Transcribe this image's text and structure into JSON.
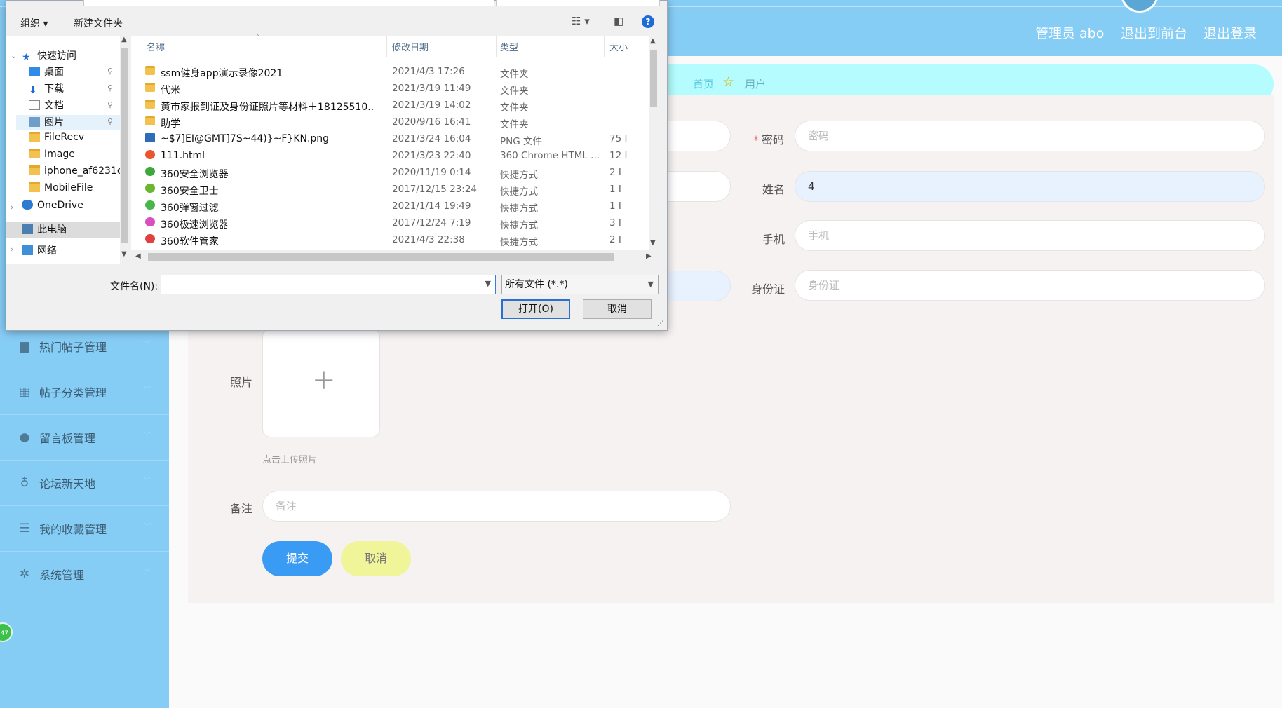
{
  "header": {
    "admin_label": "管理员 abo",
    "to_front": "退出到前台",
    "logout": "退出登录"
  },
  "sidebar": {
    "items": [
      {
        "label": "热门帖子管理",
        "icon": "post-icon"
      },
      {
        "label": "帖子分类管理",
        "icon": "grid-icon"
      },
      {
        "label": "留言板管理",
        "icon": "user-icon"
      },
      {
        "label": "论坛新天地",
        "icon": "mic-icon"
      },
      {
        "label": "我的收藏管理",
        "icon": "list-icon"
      },
      {
        "label": "系统管理",
        "icon": "settings-icon"
      }
    ],
    "float_badge": "47"
  },
  "breadcrumb": {
    "home": "首页",
    "current": "用户"
  },
  "form": {
    "password_label": "密码",
    "password_placeholder": "密码",
    "name_label": "姓名",
    "name_value": "4",
    "phone_label": "手机",
    "phone_placeholder": "手机",
    "idcard_label": "身份证",
    "idcard_placeholder": "身份证",
    "photo_label": "照片",
    "upload_hint": "点击上传照片",
    "remark_label": "备注",
    "remark_placeholder": "备注",
    "submit": "提交",
    "cancel": "取消"
  },
  "dialog": {
    "toolbar": {
      "organize": "组织 ▾",
      "new_folder": "新建文件夹"
    },
    "nav": [
      {
        "label": "快速访问",
        "icon": "star-icon"
      },
      {
        "label": "桌面",
        "icon": "desktop-icon"
      },
      {
        "label": "下载",
        "icon": "download-icon"
      },
      {
        "label": "文档",
        "icon": "document-icon"
      },
      {
        "label": "图片",
        "icon": "picture-icon"
      },
      {
        "label": "FileRecv",
        "icon": "folder-icon"
      },
      {
        "label": "Image",
        "icon": "folder-icon"
      },
      {
        "label": "iphone_af6231c",
        "icon": "folder-icon"
      },
      {
        "label": "MobileFile",
        "icon": "folder-icon"
      },
      {
        "label": "OneDrive",
        "icon": "cloud-icon"
      },
      {
        "label": "此电脑",
        "icon": "computer-icon"
      },
      {
        "label": "网络",
        "icon": "network-icon"
      }
    ],
    "columns": {
      "name": "名称",
      "date": "修改日期",
      "type": "类型",
      "size": "大小"
    },
    "files": [
      {
        "name": "ssm健身app演示录像2021",
        "date": "2021/4/3 17:26",
        "type": "文件夹",
        "size": "",
        "icon": "folder-icon"
      },
      {
        "name": "代米",
        "date": "2021/3/19 11:49",
        "type": "文件夹",
        "size": "",
        "icon": "folder-icon"
      },
      {
        "name": "黄市家报到证及身份证照片等材料＋18125510...",
        "date": "2021/3/19 14:02",
        "type": "文件夹",
        "size": "",
        "icon": "folder-icon"
      },
      {
        "name": "助学",
        "date": "2020/9/16 16:41",
        "type": "文件夹",
        "size": "",
        "icon": "folder-icon"
      },
      {
        "name": "~$7]EI@GMT]7S~44)}~F}KN.png",
        "date": "2021/3/24 16:04",
        "type": "PNG 文件",
        "size": "75 I",
        "icon": "image-file-icon"
      },
      {
        "name": "111.html",
        "date": "2021/3/23 22:40",
        "type": "360 Chrome HTML ...",
        "size": "12 I",
        "icon": "html-file-icon"
      },
      {
        "name": "360安全浏览器",
        "date": "2020/11/19 0:14",
        "type": "快捷方式",
        "size": "2 I",
        "icon": "browser-icon"
      },
      {
        "name": "360安全卫士",
        "date": "2017/12/15 23:24",
        "type": "快捷方式",
        "size": "1 I",
        "icon": "security-icon"
      },
      {
        "name": "360弹窗过滤",
        "date": "2021/1/14 19:49",
        "type": "快捷方式",
        "size": "1 I",
        "icon": "popup-filter-icon"
      },
      {
        "name": "360极速浏览器",
        "date": "2017/12/24 7:19",
        "type": "快捷方式",
        "size": "3 I",
        "icon": "browser-fast-icon"
      },
      {
        "name": "360软件管家",
        "date": "2021/4/3 22:38",
        "type": "快捷方式",
        "size": "2 I",
        "icon": "software-manager-icon"
      }
    ],
    "filename_label": "文件名(N):",
    "filename_value": "",
    "filetype": "所有文件 (*.*)",
    "open": "打开(O)",
    "cancel": "取消"
  },
  "colors": {
    "header_bg": "#86cdf6",
    "breadcrumb_bg": "#b4fcfe",
    "submit_bg": "#3a9bf5",
    "cancel_bg": "#f1f59a"
  }
}
